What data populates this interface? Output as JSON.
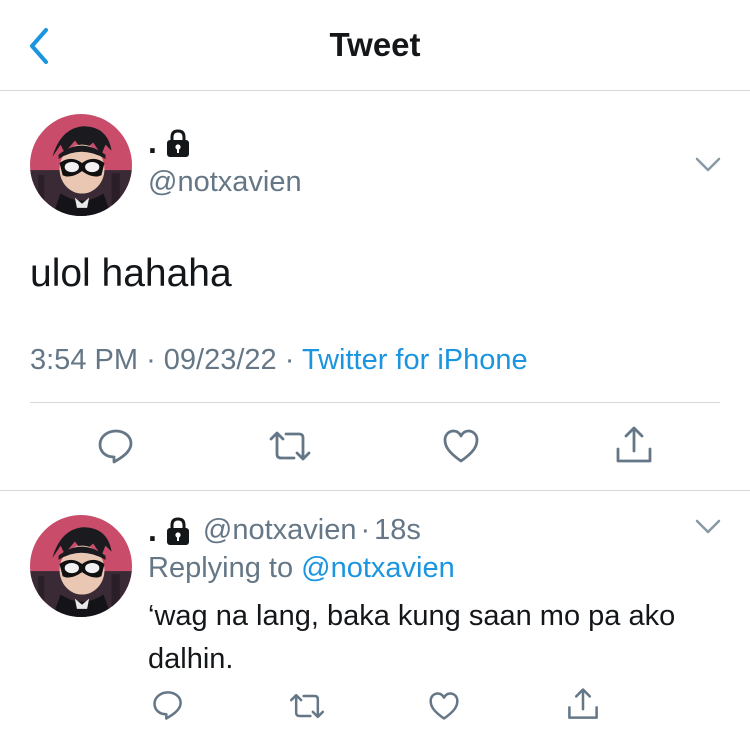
{
  "header": {
    "title": "Tweet",
    "back_icon": "chevron-left-icon"
  },
  "tweet": {
    "display_name": ".",
    "protected": true,
    "handle": "@notxavien",
    "text": "ulol hahaha",
    "time": "3:54 PM",
    "date": "09/23/22",
    "source": "Twitter for iPhone",
    "separator": "·",
    "actions": [
      "reply-icon",
      "retweet-icon",
      "like-icon",
      "share-icon"
    ]
  },
  "reply": {
    "display_name": ".",
    "protected": true,
    "handle": "@notxavien",
    "age": "18s",
    "separator": "·",
    "replying_prefix": "Replying to",
    "replying_to": "@notxavien",
    "text": "‘wag na lang, baka kung saan mo pa ako dalhin."
  },
  "colors": {
    "accent": "#1b95e0",
    "text": "#14171a",
    "secondary": "#657786",
    "divider": "#d3d6da"
  }
}
